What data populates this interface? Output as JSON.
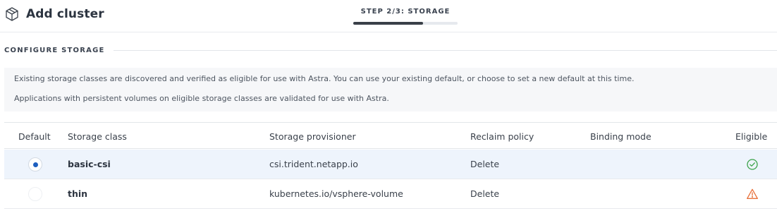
{
  "header": {
    "title": "Add cluster",
    "icon": "cube-icon",
    "step_label": "STEP 2/3: STORAGE",
    "step_progress_fraction": 0.667
  },
  "section": {
    "title": "CONFIGURE STORAGE"
  },
  "info": {
    "line1": "Existing storage classes are discovered and verified as eligible for use with Astra. You can use your existing default, or choose to set a new default at this time.",
    "line2": "Applications with persistent volumes on eligible storage classes are validated for use with Astra."
  },
  "table": {
    "columns": {
      "default": "Default",
      "storage_class": "Storage class",
      "provisioner": "Storage provisioner",
      "reclaim": "Reclaim policy",
      "binding": "Binding mode",
      "eligible": "Eligible"
    },
    "rows": [
      {
        "default_selected": true,
        "storage_class": "basic-csi",
        "provisioner": "csi.trident.netapp.io",
        "reclaim": "Delete",
        "binding": "",
        "eligible_icon": "check-circle-icon",
        "eligible_color": "#3ca34a"
      },
      {
        "default_selected": false,
        "storage_class": "thin",
        "provisioner": "kubernetes.io/vsphere-volume",
        "reclaim": "Delete",
        "binding": "",
        "eligible_icon": "warning-triangle-icon",
        "eligible_color": "#e8703a"
      }
    ]
  }
}
